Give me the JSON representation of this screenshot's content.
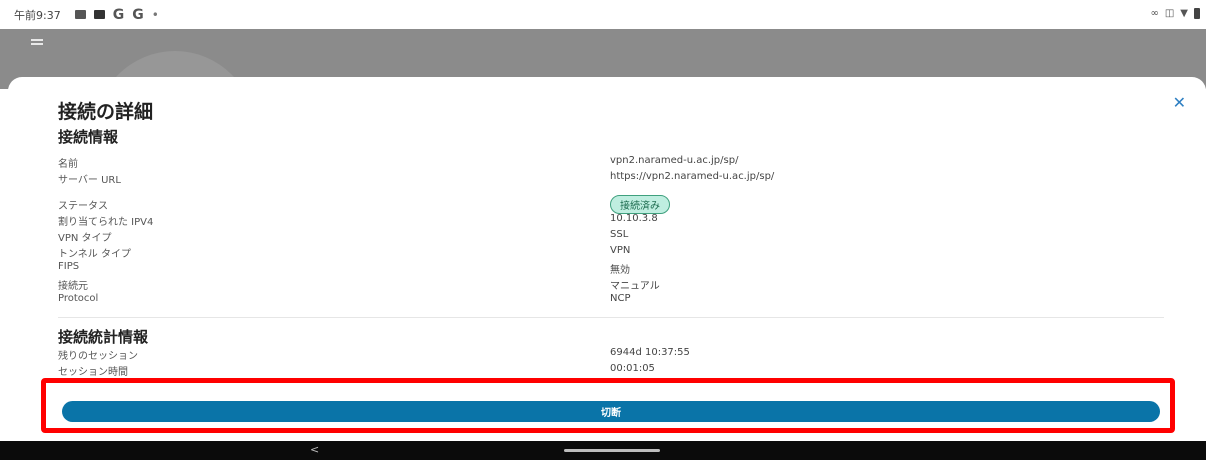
{
  "status_bar": {
    "time": "午前9:37",
    "icons": [
      "image-icon",
      "square-icon",
      "google-icon",
      "google-icon",
      "dot-icon"
    ],
    "g_letter": "G",
    "dot": "•",
    "right_icons": [
      "link-icon",
      "vibrate-icon",
      "wifi-icon",
      "battery-icon"
    ]
  },
  "sheet": {
    "title": "接続の詳細",
    "close_glyph": "✕",
    "connection_info": {
      "heading": "接続情報",
      "rows": [
        {
          "label": "名前",
          "value": "vpn2.naramed-u.ac.jp/sp/"
        },
        {
          "label": "サーバー URL",
          "value": "https://vpn2.naramed-u.ac.jp/sp/"
        },
        {
          "label": "ステータス",
          "value": "接続済み"
        },
        {
          "label": "割り当てられた IPV4",
          "value": "10.10.3.8"
        },
        {
          "label": "VPN タイプ",
          "value": "SSL"
        },
        {
          "label": "トンネル タイプ",
          "value": "VPN"
        },
        {
          "label": "FIPS",
          "value": "無効"
        },
        {
          "label": "接続元",
          "value": "マニュアル"
        },
        {
          "label": "Protocol",
          "value": "NCP"
        }
      ]
    },
    "stats": {
      "heading": "接続統計情報",
      "rows": [
        {
          "label": "残りのセッション",
          "value": "6944d 10:37:55"
        },
        {
          "label": "セッション時間",
          "value": "00:01:05"
        }
      ]
    },
    "disconnect_label": "切断"
  },
  "nav": {
    "back": "<"
  },
  "colors": {
    "accent": "#0a74a8",
    "status_badge_bg": "#bfeee0",
    "highlight": "#ff0000"
  }
}
